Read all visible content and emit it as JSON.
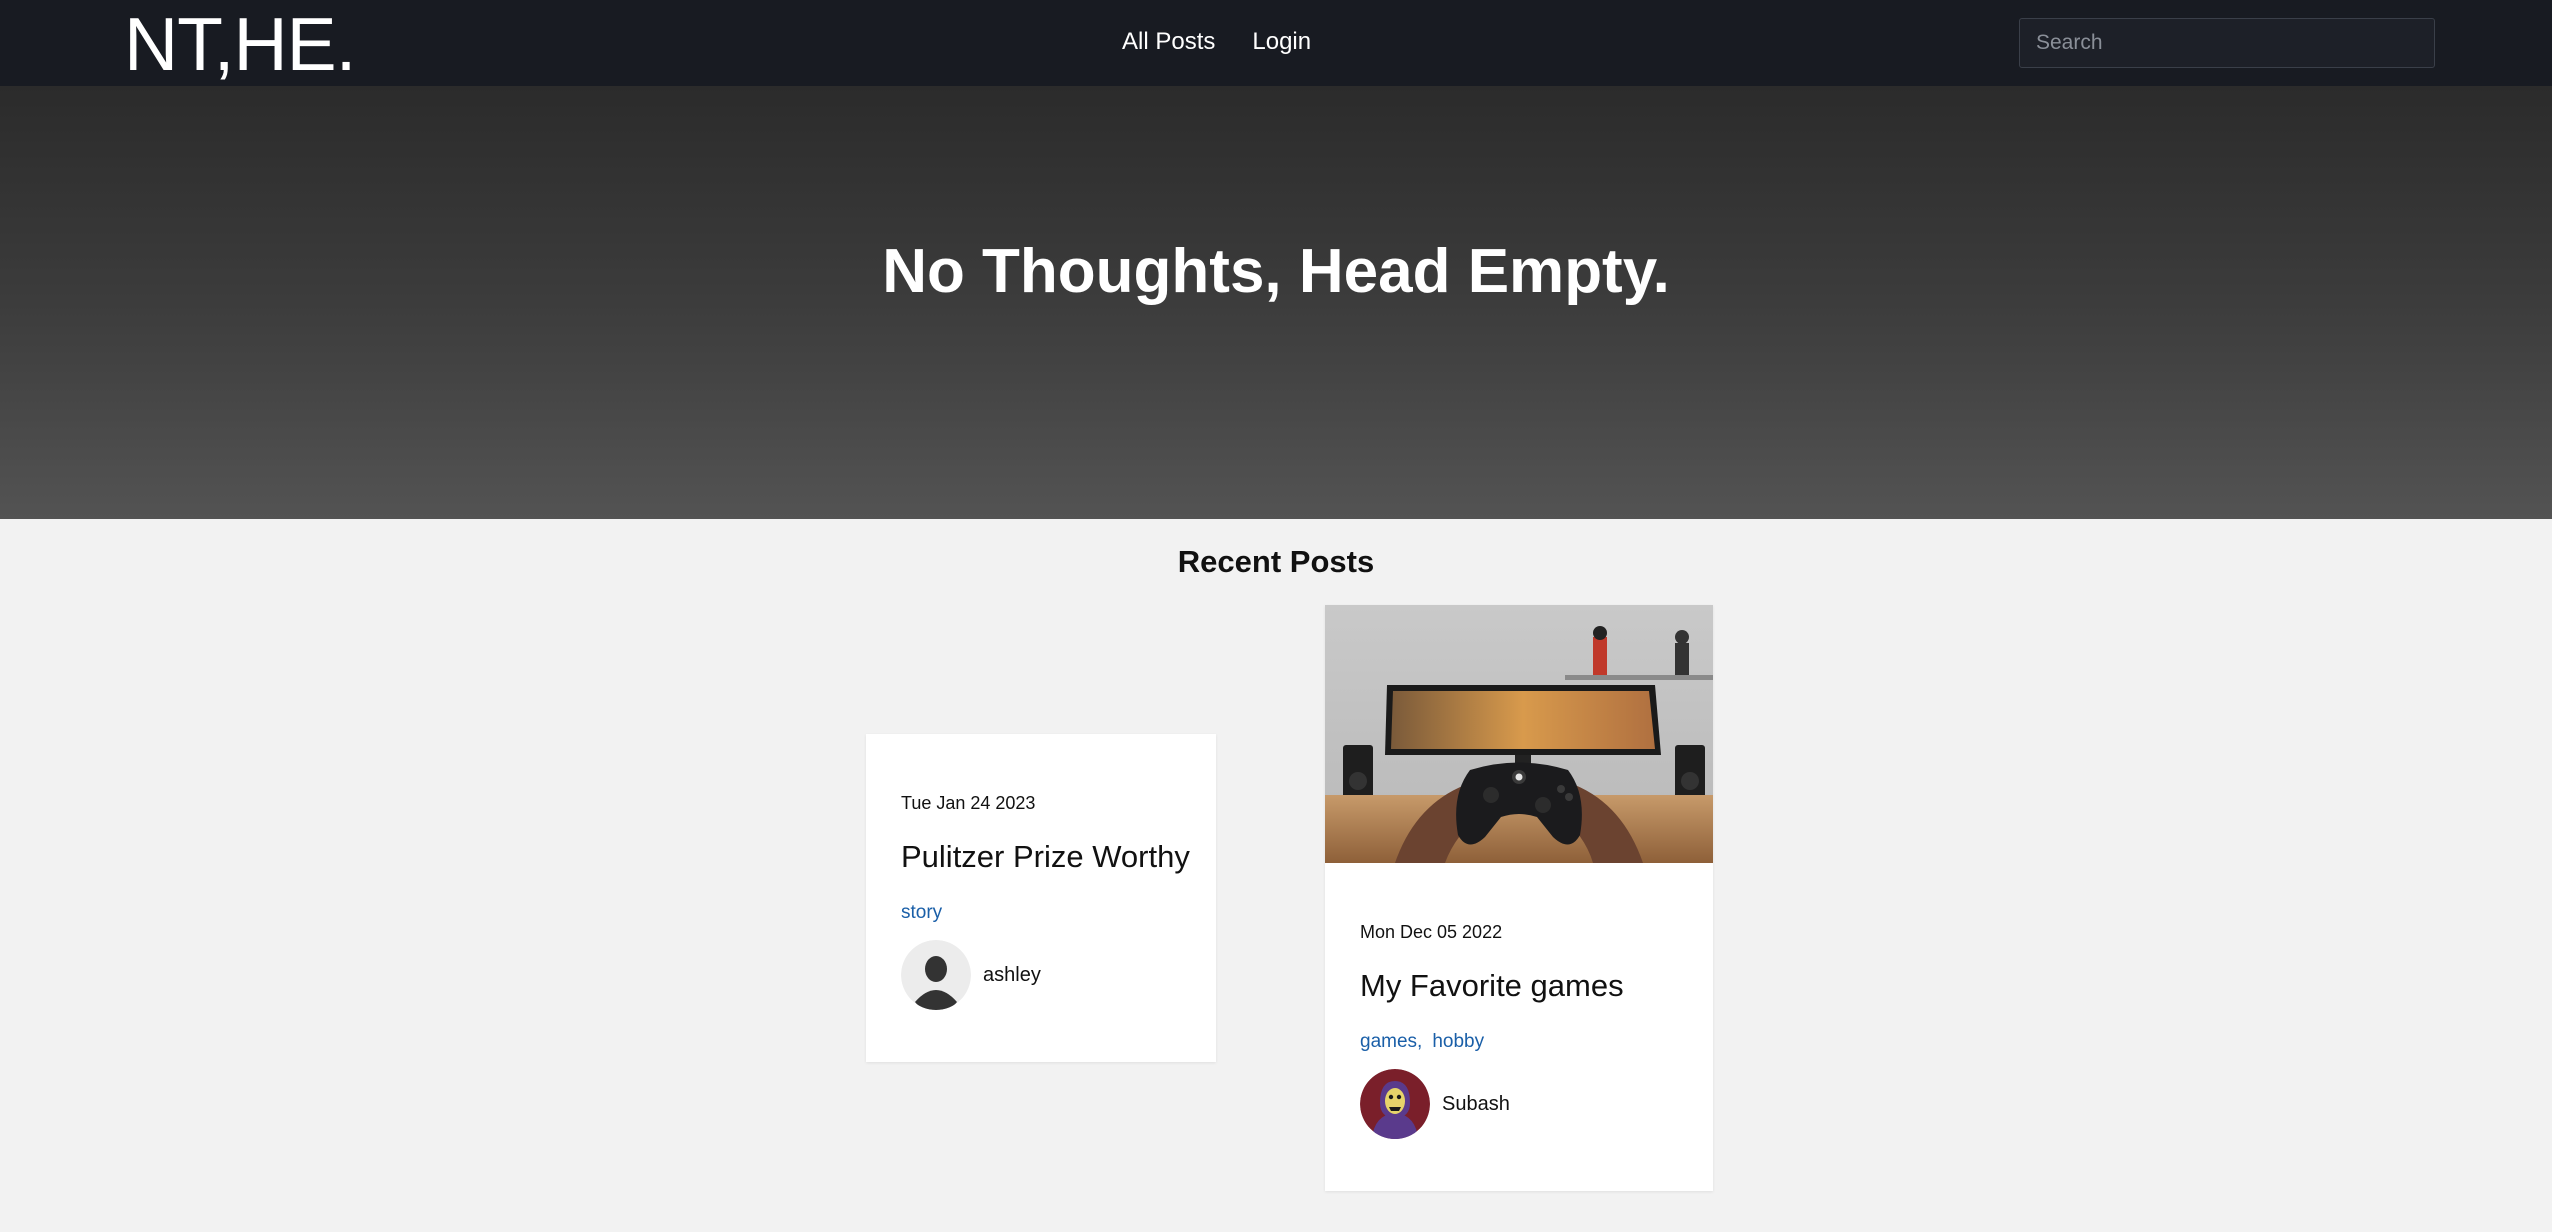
{
  "nav": {
    "brand": "NT,HE.",
    "links": [
      "All Posts",
      "Login"
    ],
    "search_placeholder": "Search"
  },
  "hero": {
    "title": "No Thoughts, Head Empty."
  },
  "recent": {
    "title": "Recent Posts",
    "posts": [
      {
        "date": "Tue Jan 24 2023",
        "title": "Pulitzer Prize Worthy",
        "tags": [
          "story"
        ],
        "author": "ashley",
        "avatar": "default-user-avatar"
      },
      {
        "date": "Mon Dec 05 2022",
        "title": "My Favorite games",
        "tags": [
          "games,",
          "hobby"
        ],
        "author": "Subash",
        "avatar": "skeletor-avatar",
        "image": "game-controller-photo"
      }
    ]
  },
  "colors": {
    "navbar_bg": "#181b22",
    "page_bg": "#f2f2f2",
    "tag_link": "#1a5fa8"
  }
}
